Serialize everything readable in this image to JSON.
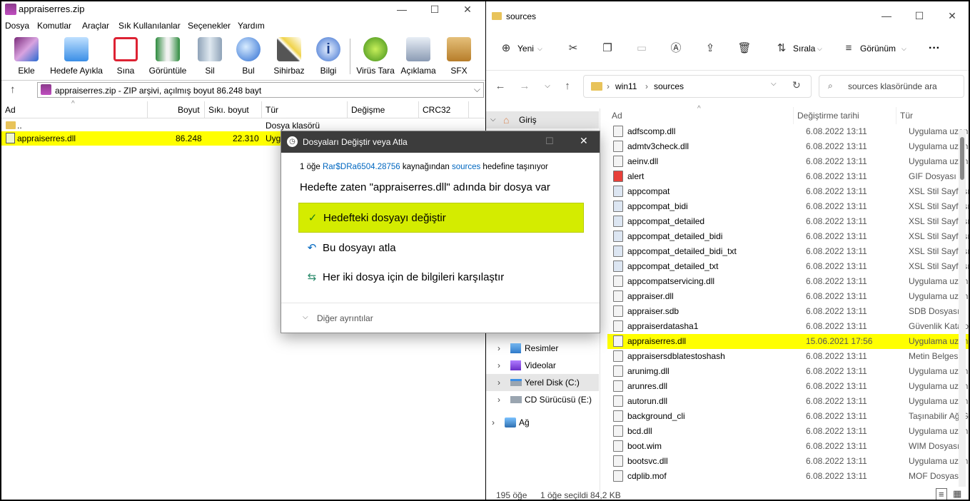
{
  "winrar": {
    "title": "appraiserres.zip",
    "menu": [
      "Dosya",
      "Komutlar",
      "Araçlar",
      "Sık Kullanılanlar",
      "Seçenekler",
      "Yardım"
    ],
    "toolbar": [
      "Ekle",
      "Hedefe Ayıkla",
      "Sına",
      "Görüntüle",
      "Sil",
      "Bul",
      "Sihirbaz",
      "Bilgi",
      "Virüs Tara",
      "Açıklama",
      "SFX"
    ],
    "address": "appraiserres.zip - ZIP arşivi, açılmış boyut 86.248 bayt",
    "columns": {
      "name": "Ad",
      "size": "Boyut",
      "packed": "Sıkı. boyut",
      "type": "Tür",
      "modified": "Değişme",
      "crc": "CRC32"
    },
    "rows": [
      {
        "name": "..",
        "size": "",
        "packed": "",
        "type": "Dosya klasörü"
      },
      {
        "name": "appraiserres.dll",
        "size": "86.248",
        "packed": "22.310",
        "type": "Uyg"
      }
    ]
  },
  "explorer": {
    "title": "sources",
    "cmd": {
      "new": "Yeni",
      "sort": "Sırala",
      "view": "Görünüm",
      "more": "···"
    },
    "path": [
      "win11",
      "sources"
    ],
    "search_placeholder": "sources klasöründe ara",
    "nav": {
      "home": "Giriş",
      "pictures": "Resimler",
      "videos": "Videolar",
      "localdisk": "Yerel Disk (C:)",
      "cd": "CD Sürücüsü (E:)",
      "network": "Ağ"
    },
    "columns": {
      "name": "Ad",
      "modified": "Değiştirme tarihi",
      "type": "Tür"
    },
    "files": [
      {
        "name": "adfscomp.dll",
        "date": "6.08.2022 13:11",
        "type": "Uygulama uzan"
      },
      {
        "name": "admtv3check.dll",
        "date": "6.08.2022 13:11",
        "type": "Uygulama uzan"
      },
      {
        "name": "aeinv.dll",
        "date": "6.08.2022 13:11",
        "type": "Uygulama uzan"
      },
      {
        "name": "alert",
        "date": "6.08.2022 13:11",
        "type": "GIF Dosyası"
      },
      {
        "name": "appcompat",
        "date": "6.08.2022 13:11",
        "type": "XSL Stil Sayfası"
      },
      {
        "name": "appcompat_bidi",
        "date": "6.08.2022 13:11",
        "type": "XSL Stil Sayfası"
      },
      {
        "name": "appcompat_detailed",
        "date": "6.08.2022 13:11",
        "type": "XSL Stil Sayfası"
      },
      {
        "name": "appcompat_detailed_bidi",
        "date": "6.08.2022 13:11",
        "type": "XSL Stil Sayfası"
      },
      {
        "name": "appcompat_detailed_bidi_txt",
        "date": "6.08.2022 13:11",
        "type": "XSL Stil Sayfası"
      },
      {
        "name": "appcompat_detailed_txt",
        "date": "6.08.2022 13:11",
        "type": "XSL Stil Sayfası"
      },
      {
        "name": "appcompatservicing.dll",
        "date": "6.08.2022 13:11",
        "type": "Uygulama uzan"
      },
      {
        "name": "appraiser.dll",
        "date": "6.08.2022 13:11",
        "type": "Uygulama uzan"
      },
      {
        "name": "appraiser.sdb",
        "date": "6.08.2022 13:11",
        "type": "SDB Dosyası"
      },
      {
        "name": "appraiserdatasha1",
        "date": "6.08.2022 13:11",
        "type": "Güvenlik Katalo"
      },
      {
        "name": "appraiserres.dll",
        "date": "15.06.2021 17:56",
        "type": "Uygulama uzan"
      },
      {
        "name": "appraisersdblatestoshash",
        "date": "6.08.2022 13:11",
        "type": "Metin Belgesi"
      },
      {
        "name": "arunimg.dll",
        "date": "6.08.2022 13:11",
        "type": "Uygulama uzan"
      },
      {
        "name": "arunres.dll",
        "date": "6.08.2022 13:11",
        "type": "Uygulama uzan"
      },
      {
        "name": "autorun.dll",
        "date": "6.08.2022 13:11",
        "type": "Uygulama uzan"
      },
      {
        "name": "background_cli",
        "date": "6.08.2022 13:11",
        "type": "Taşınabilir Ağ G"
      },
      {
        "name": "bcd.dll",
        "date": "6.08.2022 13:11",
        "type": "Uygulama uzan"
      },
      {
        "name": "boot.wim",
        "date": "6.08.2022 13:11",
        "type": "WIM Dosyası"
      },
      {
        "name": "bootsvc.dll",
        "date": "6.08.2022 13:11",
        "type": "Uygulama uzan"
      },
      {
        "name": "cdplib.mof",
        "date": "6.08.2022 13:11",
        "type": "MOF Dosyası"
      }
    ],
    "status": {
      "count": "195 öğe",
      "selected": "1 öğe seçildi  84,2 KB"
    }
  },
  "dialog": {
    "title": "Dosyaları Değiştir veya Atla",
    "line1_prefix": "1 öğe ",
    "line1_source": "Rar$DRa6504.28756",
    "line1_mid": " kaynağından ",
    "line1_dest": "sources",
    "line1_suffix": " hedefine taşınıyor",
    "message": "Hedefte zaten \"appraiserres.dll\" adında bir dosya var",
    "options": [
      "Hedefteki dosyayı değiştir",
      "Bu dosyayı atla",
      "Her iki dosya için de bilgileri karşılaştır"
    ],
    "more": "Diğer ayrıntılar"
  },
  "colors": {
    "highlight": "#ffff00",
    "dialog_highlight": "#d4ec00",
    "link": "#0067c0"
  }
}
